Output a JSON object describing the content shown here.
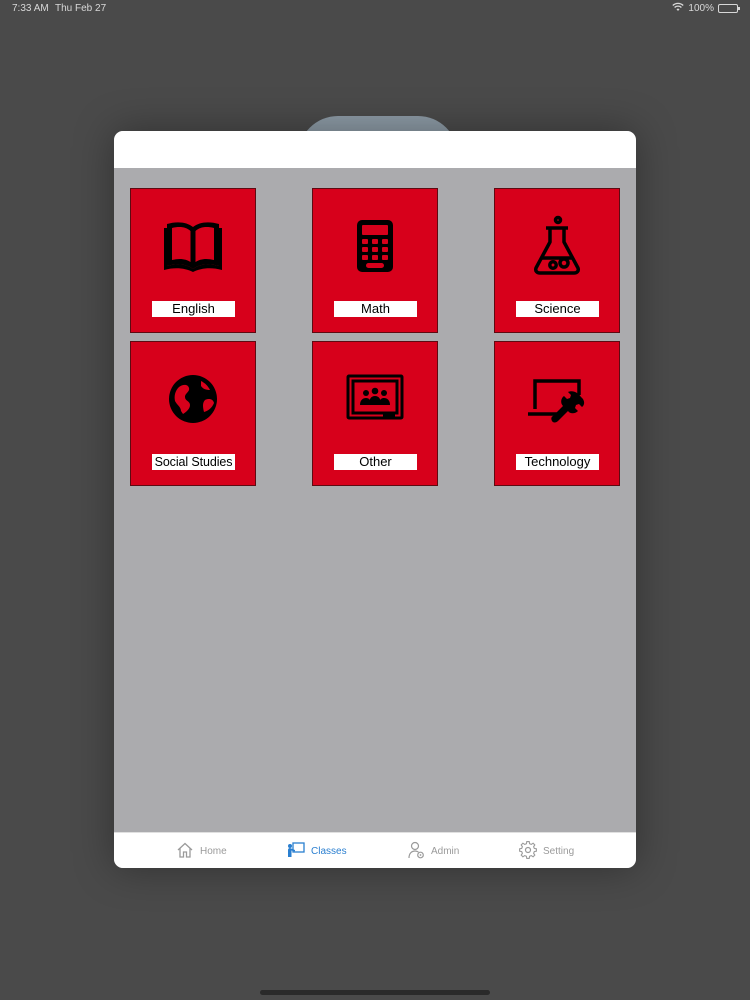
{
  "status_bar": {
    "time": "7:33 AM",
    "date": "Thu Feb 27",
    "battery": "100%",
    "battery_level": 1.0
  },
  "subjects": [
    {
      "label": "English",
      "icon": "book-icon"
    },
    {
      "label": "Math",
      "icon": "calculator-icon"
    },
    {
      "label": "Science",
      "icon": "flask-icon"
    },
    {
      "label": "Social Studies",
      "icon": "globe-icon"
    },
    {
      "label": "Other",
      "icon": "classroom-icon"
    },
    {
      "label": "Technology",
      "icon": "laptop-wrench-icon"
    }
  ],
  "tabs": [
    {
      "label": "Home",
      "icon": "home-icon",
      "active": false
    },
    {
      "label": "Classes",
      "icon": "teacher-board-icon",
      "active": true
    },
    {
      "label": "Admin",
      "icon": "admin-user-icon",
      "active": false
    },
    {
      "label": "Setting",
      "icon": "gear-icon",
      "active": false
    }
  ],
  "colors": {
    "tile": "#d7001b",
    "active_tab": "#2a7fd0",
    "inactive_tab": "#9a9a9a",
    "modal_body": "#ababae"
  }
}
